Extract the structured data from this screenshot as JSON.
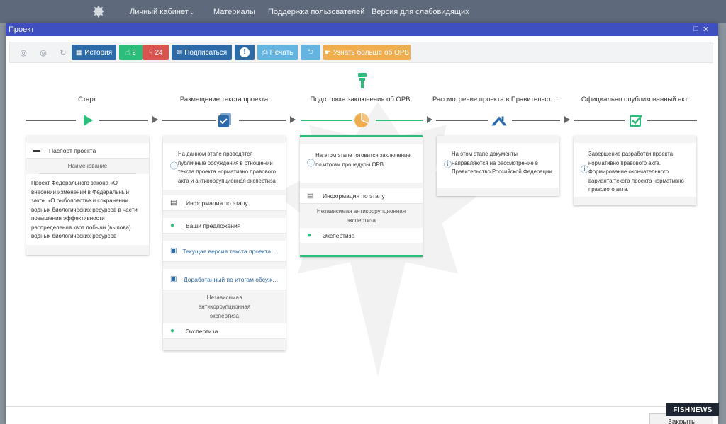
{
  "topnav": {
    "items": [
      "Личный кабинет",
      "Материалы",
      "Поддержка пользователей",
      "Версия для слабовидящих"
    ]
  },
  "modal": {
    "title": "Проект",
    "toolbar": {
      "history": "История",
      "likes": "2",
      "dislikes": "24",
      "subscribe": "Подписаться",
      "print": "Печать",
      "learn_more": "Узнать больше об ОРВ"
    },
    "close_label": "Закрыть"
  },
  "stages": [
    {
      "title": "Старт"
    },
    {
      "title": "Размещение текста проекта"
    },
    {
      "title": "Подготовка заключения об ОРВ"
    },
    {
      "title": "Рассмотрение проекта в Правительстве Российской Федерации"
    },
    {
      "title": "Официально опубликованный акт"
    }
  ],
  "card_start": {
    "passport": "Паспорт проекта",
    "name_label": "Наименование",
    "name_text": "Проект Федерального закона «О внесении изменений в Федеральный закон «О рыболовстве и сохранении водных биологических ресурсов в части повышения эффективности распределения квот добычи (вылова) водных биологических ресурсов"
  },
  "card_text": {
    "info": "На данном этапе проводятся публичные обсуждения в отношении текста проекта нормативно правового акта и антикоррупционная экспертиза",
    "stage_info": "Информация по этапу",
    "proposals": "Ваши предложения",
    "current_version": "Текущая версия текста проекта нормативно правового акта",
    "revised": "Доработанный по итогам обсуждения текст",
    "anticorruption": "Независимая антикоррупционная экспертиза",
    "expertise": "Экспертиза"
  },
  "card_orv": {
    "info": "На этом этапе готовится заключение по итогам процедуры ОРВ",
    "stage_info": "Информация по этапу",
    "anticorruption": "Независимая антикоррупционная экспертиза",
    "expertise": "Экспертиза"
  },
  "card_gov": {
    "info": "На этом этапе документы направляются на рассмотрение в Правительство Российской Федерации"
  },
  "card_pub": {
    "info": "Завершение разработки проекта нормативно правового акта. Формирование окончательного варианта текста проекта нормативно правового акта."
  },
  "watermark_text": "FISHNEWS",
  "colors": {
    "header": "#3e4fbf",
    "green": "#2bbd7a",
    "orange": "#f0ad4e",
    "blue": "#2d6aa8"
  }
}
